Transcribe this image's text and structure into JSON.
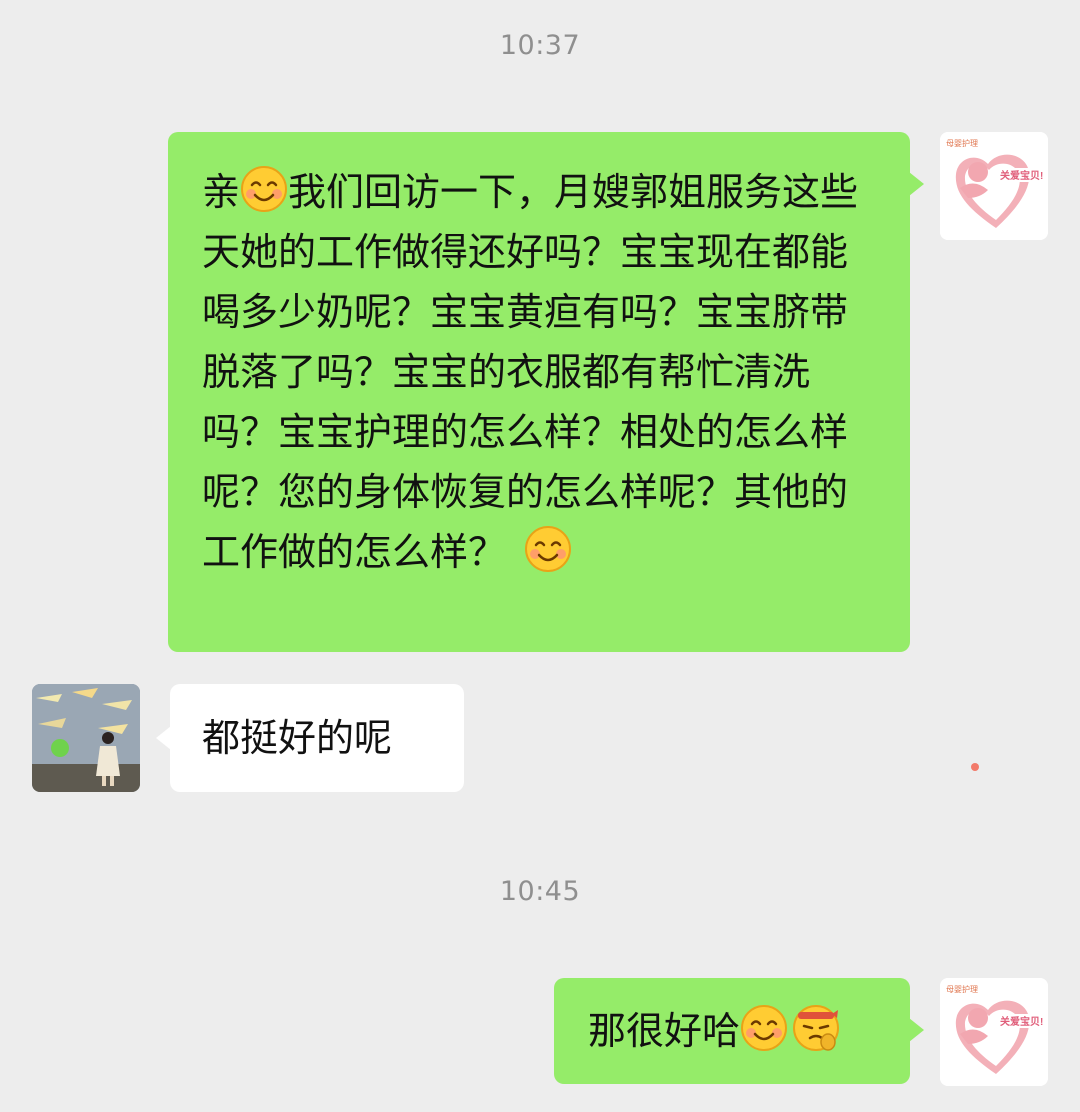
{
  "timestamps": {
    "first": "10:37",
    "second": "10:45"
  },
  "messages": {
    "m1": {
      "sender": "self",
      "greeting": "亲",
      "body": "我们回访一下，月嫂郭姐服务这些天她的工作做得还好吗？宝宝现在都能喝多少奶呢？宝宝黄疸有吗？宝宝脐带脱落了吗？宝宝的衣服都有帮忙清洗吗？宝宝护理的怎么样？相处的怎么样呢？您的身体恢复的怎么样呢？其他的工作做的怎么样？",
      "emojis": [
        "smile-emoji",
        "smile-emoji"
      ]
    },
    "m2": {
      "sender": "contact",
      "text": "都挺好的呢"
    },
    "m3": {
      "sender": "self",
      "text": "那很好哈",
      "emojis": [
        "smile-emoji",
        "facepalm-emoji"
      ]
    }
  },
  "self_avatar": {
    "small_text": "母婴护理",
    "banner_text": "关爱宝贝!"
  },
  "colors": {
    "outgoing": "#95ec69",
    "incoming": "#ffffff",
    "background": "#ededed",
    "timestamp": "#8f8f8f"
  }
}
